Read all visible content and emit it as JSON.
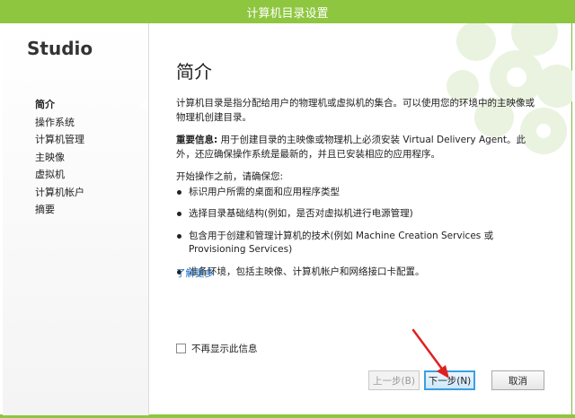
{
  "window": {
    "title": "计算机目录设置"
  },
  "sidebar": {
    "brand": "Studio",
    "items": [
      {
        "label": "简介",
        "active": true
      },
      {
        "label": "操作系统"
      },
      {
        "label": "计算机管理"
      },
      {
        "label": "主映像"
      },
      {
        "label": "虚拟机"
      },
      {
        "label": "计算机帐户"
      },
      {
        "label": "摘要"
      }
    ]
  },
  "main": {
    "title": "简介",
    "intro": "计算机目录是指分配给用户的物理机或虚拟机的集合。可以使用您的环境中的主映像或物理机创建目录。",
    "important_label": "重要信息:",
    "important_text": " 用于创建目录的主映像或物理机上必须安装 Virtual Delivery Agent。此外，还应确保操作系统是最新的，并且已安装相应的应用程序。",
    "before_start": "开始操作之前，请确保您:",
    "bullets": [
      "标识用户所需的桌面和应用程序类型",
      "选择目录基础结构(例如，是否对虚拟机进行电源管理)",
      "包含用于创建和管理计算机的技术(例如 Machine Creation Services 或 Provisioning Services)",
      "准备环境，包括主映像、计算机帐户和网络接口卡配置。"
    ],
    "learn_more": "了解更多"
  },
  "footer": {
    "dont_show": "不再显示此信息",
    "dont_show_checked": false,
    "prev_label": "上一步(B)",
    "next_label": "下一步(N)",
    "cancel_label": "取消"
  },
  "colors": {
    "titlebar": "#8ec63f",
    "link": "#1a6fc4",
    "arrow": "#e02020",
    "focus": "#3c9fe0"
  }
}
